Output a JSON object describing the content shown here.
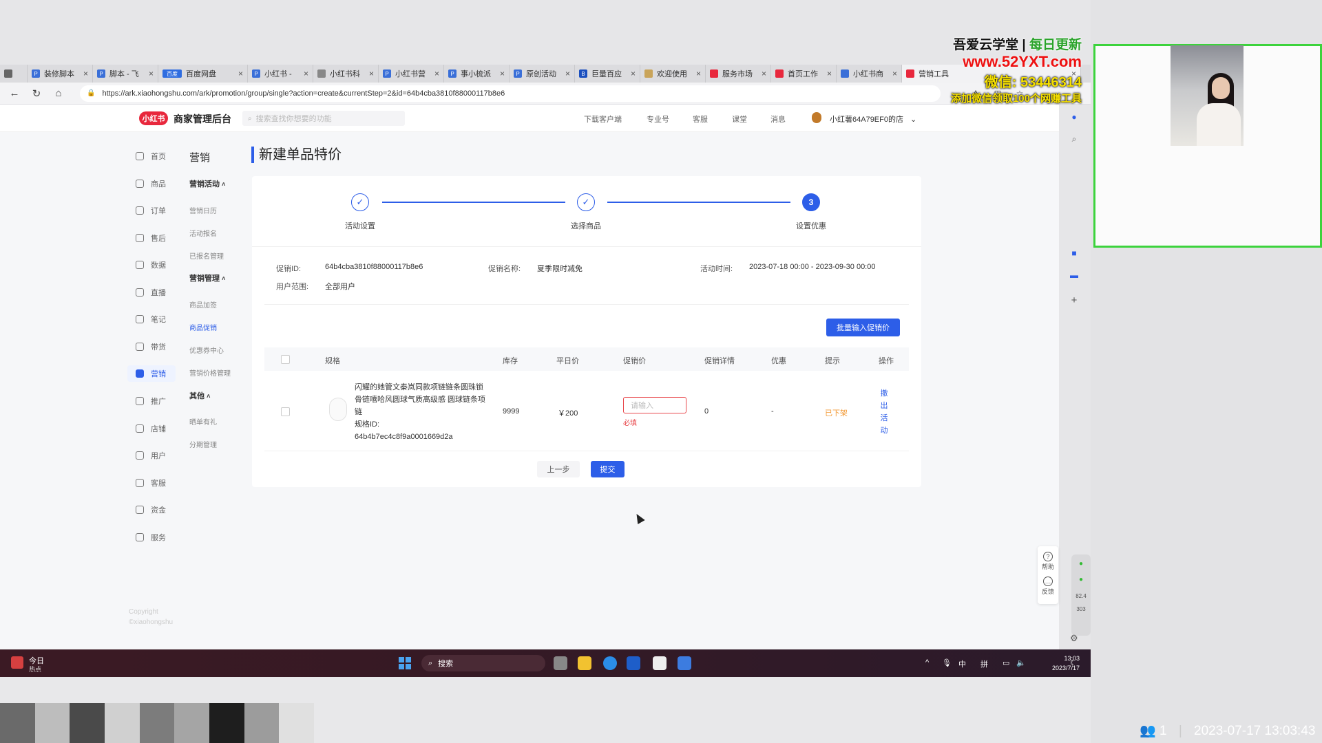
{
  "browser": {
    "tabs": [
      {
        "label": "装修脚本"
      },
      {
        "label": "脚本 - 飞"
      },
      {
        "label": "百度网盘",
        "prefix": "百度"
      },
      {
        "label": "小红书 -"
      },
      {
        "label": "小红书科"
      },
      {
        "label": "小红书营"
      },
      {
        "label": "事小梳派"
      },
      {
        "label": "原创活动"
      },
      {
        "label": "巨量百应"
      },
      {
        "label": "欢迎使用"
      },
      {
        "label": "服务市场"
      },
      {
        "label": "首页工作"
      },
      {
        "label": "小红书商"
      },
      {
        "label": "营销工具"
      }
    ],
    "url": "https://ark.xiaohongshu.com/ark/promotion/group/single?action=create&currentStep=2&id=64b4cba3810f88000117b8e6"
  },
  "header": {
    "logo": "小红书",
    "app_title": "商家管理后台",
    "search_placeholder": "搜索查找你想要的功能",
    "links": [
      "下载客户端",
      "专业号",
      "客服",
      "课堂",
      "消息"
    ],
    "shop_name": "小红薯64A79EF0的店"
  },
  "sidebar": {
    "items": [
      {
        "label": "首页"
      },
      {
        "label": "商品"
      },
      {
        "label": "订单"
      },
      {
        "label": "售后"
      },
      {
        "label": "数据"
      },
      {
        "label": "直播"
      },
      {
        "label": "笔记"
      },
      {
        "label": "带货"
      },
      {
        "label": "营销"
      },
      {
        "label": "推广"
      },
      {
        "label": "店铺"
      },
      {
        "label": "用户"
      },
      {
        "label": "客服"
      },
      {
        "label": "资金"
      },
      {
        "label": "服务"
      }
    ],
    "copyright_1": "Copyright",
    "copyright_2": "©xiaohongshu"
  },
  "subnav": {
    "title": "营销",
    "group1": "营销活动",
    "group1_items": [
      "营销日历",
      "活动报名",
      "已报名管理"
    ],
    "group2": "营销管理",
    "group2_items": [
      "商品加签",
      "商品促销",
      "优惠券中心",
      "营销价格管理"
    ],
    "group3": "其他",
    "group3_items": [
      "晒单有礼",
      "分期管理"
    ]
  },
  "main": {
    "page_title": "新建单品特价",
    "steps": [
      {
        "label": "活动设置",
        "mark": "✓"
      },
      {
        "label": "选择商品",
        "mark": "✓"
      },
      {
        "label": "设置优惠",
        "mark": "3"
      }
    ],
    "info": {
      "promo_id_label": "促销ID:",
      "promo_id": "64b4cba3810f88000117b8e6",
      "promo_name_label": "促销名称:",
      "promo_name": "夏季限时减免",
      "time_label": "活动时间:",
      "time": "2023-07-18 00:00 - 2023-09-30 00:00",
      "scope_label": "用户范围:",
      "scope": "全部用户"
    },
    "batch_button": "批量输入促销价",
    "table": {
      "headers": [
        "规格",
        "库存",
        "平日价",
        "促销价",
        "促销详情",
        "优惠",
        "提示",
        "操作"
      ],
      "row": {
        "name": "闪耀的她管文秦岚同款项链链条圆珠锁骨链嘻哈风圆球气质高级感 圆球链条项链",
        "spec_id_label": "规格ID:",
        "spec_id": "64b4b7ec4c8f9a0001669d2a",
        "stock": "9999",
        "price": "￥200",
        "promo_placeholder": "请输入",
        "required": "必填",
        "detail": "0",
        "discount": "-",
        "tip": "已下架",
        "action": "撤出活动"
      }
    },
    "prev_button": "上一步",
    "submit_button": "提交"
  },
  "floating": {
    "help": "帮助",
    "feedback": "反馈",
    "speed1": "82.4",
    "speed2": "303"
  },
  "taskbar": {
    "news_label": "今日",
    "news_sub": "热点",
    "search": "搜索",
    "ime": "中",
    "ime2": "拼",
    "time": "13:03",
    "date": "2023/7/17"
  },
  "overlay": {
    "line1_a": "吾爱云学堂",
    "line1_sep": " | ",
    "line1_b": "每日更新",
    "line2": "www.52YXT.com",
    "line3": "微信: 53446314",
    "line4": "添加微信领取100个网赚工具",
    "viewers": "1",
    "timestamp": "2023-07-17 13:03:43"
  },
  "colors": {
    "accent": "#2d5ee8",
    "brand": "#e8283d",
    "warn": "#f29b38",
    "error": "#e8464a"
  }
}
